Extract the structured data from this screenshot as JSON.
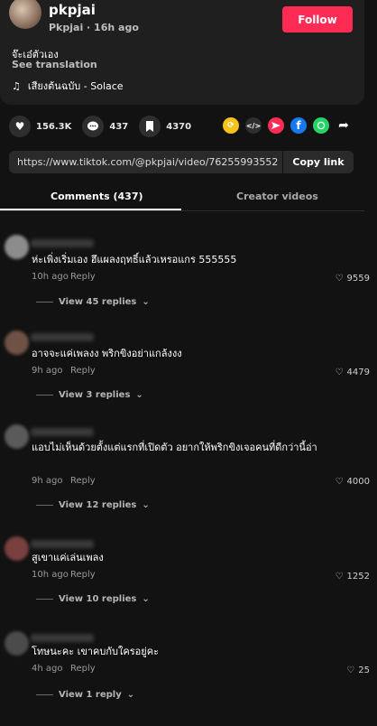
{
  "video": {
    "username": "pkpjai",
    "display_meta": "Pkpjai · 16h ago",
    "follow_label": "Follow",
    "caption": "จ๊ะเอ๋ตัวเอง",
    "see_translation": "See translation",
    "music_icon": "♫",
    "music": "เสียงต้นฉบับ - Solace"
  },
  "actions": {
    "likes": "156.3K",
    "comments": "437",
    "saves": "4370"
  },
  "share": {
    "url": "https://www.tiktok.com/@pkpjai/video/762559935521...",
    "copy_label": "Copy link"
  },
  "tabs": [
    {
      "label": "Comments (437)"
    },
    {
      "label": "Creator videos"
    }
  ],
  "comments": [
    {
      "text": "ห่ะเพิ่งเริ่มเอง ฮึแผลงฤทธิ์แล้วเหรอแกร 555555",
      "time": "10h ago",
      "reply": "Reply",
      "likes": "9559",
      "view_replies": "View 45 replies"
    },
    {
      "text": "อาจจะแค่เพลงง พริกขิงอย่าแกล้งงง",
      "time": "9h ago",
      "reply": "Reply",
      "likes": "4479",
      "view_replies": "View 3 replies"
    },
    {
      "text": "แอบไม่เห็นด้วยตั้งแต่แรกที่เปิดตัว อยากให้พริกขิงเจอคนที่ดีกว่านี้อ่า",
      "time": "9h ago",
      "reply": "Reply",
      "likes": "4000",
      "view_replies": "View 12 replies"
    },
    {
      "text": "สูเขาแค่เล่นเพลง",
      "time": "10h ago",
      "reply": "Reply",
      "likes": "1252",
      "view_replies": "View 10 replies"
    },
    {
      "text": "โทษนะคะ เขาคบกับใครอยู่คะ",
      "time": "4h ago",
      "reply": "Reply",
      "likes": "25",
      "view_replies": "View 1 reply"
    }
  ],
  "colors": {
    "accent": "#fe2c55",
    "background": "#121212"
  }
}
